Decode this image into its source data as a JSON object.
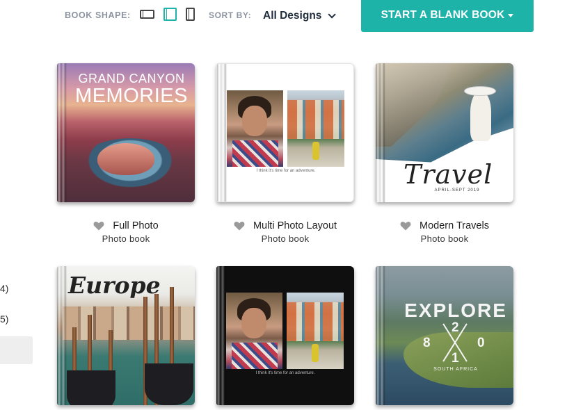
{
  "toolbar": {
    "book_shape_label": "BOOK SHAPE:",
    "shapes": [
      {
        "name": "landscape",
        "icon": "landscape-book-icon",
        "selected": false
      },
      {
        "name": "square",
        "icon": "square-book-icon",
        "selected": true
      },
      {
        "name": "portrait",
        "icon": "portrait-book-icon",
        "selected": false
      }
    ],
    "sort_label": "SORT BY:",
    "sort_value": "All Designs",
    "blank_book_label": "START A BLANK BOOK",
    "accent_color": "#1eb3a9"
  },
  "sidebar": {
    "counts": [
      "4)",
      "5)"
    ]
  },
  "books": [
    {
      "title": "Full Photo",
      "subtitle": "Photo book",
      "cover_title_1": "GRAND CANYON",
      "cover_title_2": "MEMORIES"
    },
    {
      "title": "Multi Photo Layout",
      "subtitle": "Photo book",
      "cover_caption": "I think it's time for an adventure."
    },
    {
      "title": "Modern Travels",
      "subtitle": "Photo book",
      "cover_word": "Travel",
      "cover_dates": "APRIL-SEPT 2019"
    },
    {
      "cover_word": "Europe"
    },
    {
      "cover_caption": "I think it's time for an adventure."
    },
    {
      "cover_word": "EXPLORE",
      "cover_numbers": [
        "2",
        "8",
        "0",
        "1"
      ],
      "cover_subtitle": "SOUTH AFRICA"
    }
  ]
}
